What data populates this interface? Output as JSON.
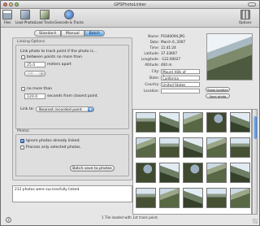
{
  "window": {
    "title": "GPSPhotoLinker"
  },
  "toolbar": [
    {
      "label": "Files",
      "icon": "files-icon"
    },
    {
      "label": "Load Photos",
      "icon": "load-photos-icon"
    },
    {
      "label": "Load Tracks",
      "icon": "load-tracks-icon"
    },
    {
      "label": "Geocode & Tracks",
      "icon": "geocode-icon"
    },
    {
      "label": "Options",
      "icon": "options-icon"
    }
  ],
  "tabs": [
    "Standard",
    "Manual",
    "Batch"
  ],
  "active_tab": "Batch",
  "linking": {
    "title": "Linking Options",
    "intro": "Link photo to track point if the photo is...",
    "between_label": "between points no more than",
    "between_value": "25.0",
    "between_unit": "meters apart",
    "units_popup": "OR",
    "no_more_label": "no more than",
    "seconds_value": "120.0",
    "seconds_unit": "seconds from closest point.",
    "link_to_label": "Link to:",
    "link_to_value": "Nearest recorded point"
  },
  "photos": {
    "title": "Photos",
    "ignore_label": "Ignore photos already linked.",
    "ignore_checked": "✓",
    "process_label": "Process only selected photos."
  },
  "batch_button": "Batch save to photos",
  "status_text": "212 photos were successfully linked.",
  "info": {
    "name_label": "Name:",
    "name_value": "P1040094.JPG",
    "date_label": "Date:",
    "date_value": "March 6, 2007",
    "time_label": "Time:",
    "time_value": "11:41:24",
    "latitude_label": "Latitude:",
    "latitude_value": "37.33607",
    "longitude_label": "Longitude:",
    "longitude_value": "-122.00027",
    "altitude_label": "Altitude:",
    "altitude_value": "400 m",
    "city_label": "City:",
    "city_value": "Mount Hills of Sanjose",
    "state_label": "State:",
    "state_value": "California",
    "country_label": "Country:",
    "country_value": "United States",
    "location_label": "Location:",
    "location_value": ""
  },
  "side_buttons": {
    "reverse": "Show location",
    "save": "Save photo"
  },
  "bottom_status": "1 Tile loaded with 1st track point."
}
